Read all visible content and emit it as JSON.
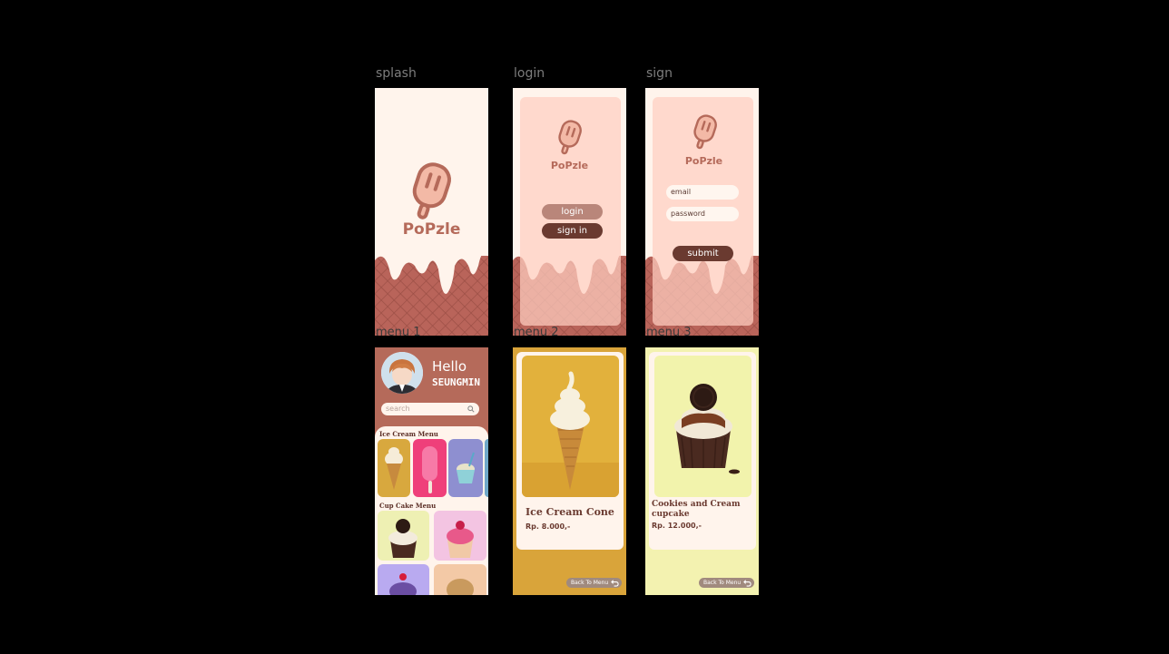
{
  "frames": {
    "splash": {
      "label": "splash",
      "brand": "PoPzle"
    },
    "login": {
      "label": "login",
      "brand": "PoPzle",
      "login_btn": "login",
      "signin_btn": "sign in"
    },
    "sign": {
      "label": "sign",
      "brand": "PoPzle",
      "email_placeholder": "email",
      "password_placeholder": "password",
      "submit_btn": "submit"
    },
    "menu1": {
      "label": "menu 1",
      "greeting": "Hello",
      "username": "SEUNGMIN",
      "search_placeholder": "search",
      "ice_cream_section": "Ice Cream Menu",
      "cupcake_section": "Cup Cake Menu"
    },
    "menu2": {
      "label": "menu 2",
      "title": "Ice Cream Cone",
      "price": "Rp. 8.000,-",
      "back": "Back To Menu"
    },
    "menu3": {
      "label": "menu 3",
      "title": "Cookies and Cream cupcake",
      "price": "Rp. 12.000,-",
      "back": "Back To Menu"
    }
  },
  "colors": {
    "background": "#000000",
    "cream": "#fff4ec",
    "peach": "#ffd9cf",
    "brand": "#b56a5a",
    "dark_brown": "#6a3a30",
    "yellow": "#d9a43a",
    "pale_yellow": "#f3f2b0"
  }
}
